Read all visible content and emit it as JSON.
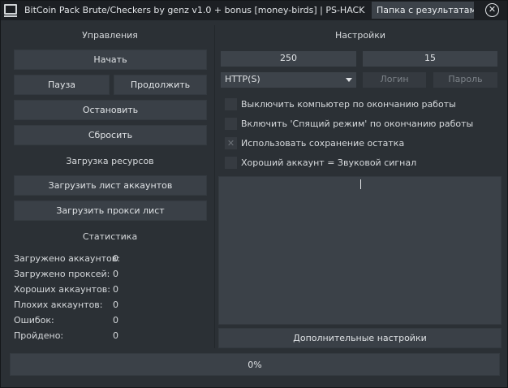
{
  "window": {
    "title": "BitCoin Pack Brute/Checkers by genz v1.0 + bonus [money-birds] | PS-HACK…",
    "results_button": "Папка с результатами",
    "close_icon": "close-icon"
  },
  "controls": {
    "header": "Управления",
    "start": "Начать",
    "pause": "Пауза",
    "resume": "Продолжить",
    "stop": "Остановить",
    "reset": "Сбросить"
  },
  "resources": {
    "header": "Загрузка ресурсов",
    "load_accounts": "Загрузить лист аккаунтов",
    "load_proxies": "Загрузить прокси лист"
  },
  "stats": {
    "header": "Статистика",
    "items": [
      {
        "label": "Загружено аккаунтов:",
        "value": "0"
      },
      {
        "label": "Загружено проксей:",
        "value": "0"
      },
      {
        "label": "Хороших аккаунтов:",
        "value": "0"
      },
      {
        "label": "Плохих аккаунтов:",
        "value": "0"
      },
      {
        "label": "Ошибок:",
        "value": "0"
      },
      {
        "label": "Пройдено:",
        "value": "0"
      }
    ]
  },
  "settings": {
    "header": "Настройки",
    "threads_value": "250",
    "timeout_value": "15",
    "proxy_type": "HTTP(S)",
    "login_placeholder": "Логин",
    "password_placeholder": "Пароль",
    "options": [
      {
        "label": "Выключить компьютер по окончанию работы",
        "checked": false
      },
      {
        "label": "Включить 'Спящий режим'  по окончанию работы",
        "checked": false
      },
      {
        "label": "Использовать сохранение остатка",
        "checked": true
      },
      {
        "label": "Хороший аккаунт = Звуковой сигнал",
        "checked": false
      }
    ],
    "log_text": "",
    "advanced": "Дополнительные настройки"
  },
  "progress": {
    "text": "0%",
    "value": 0
  }
}
